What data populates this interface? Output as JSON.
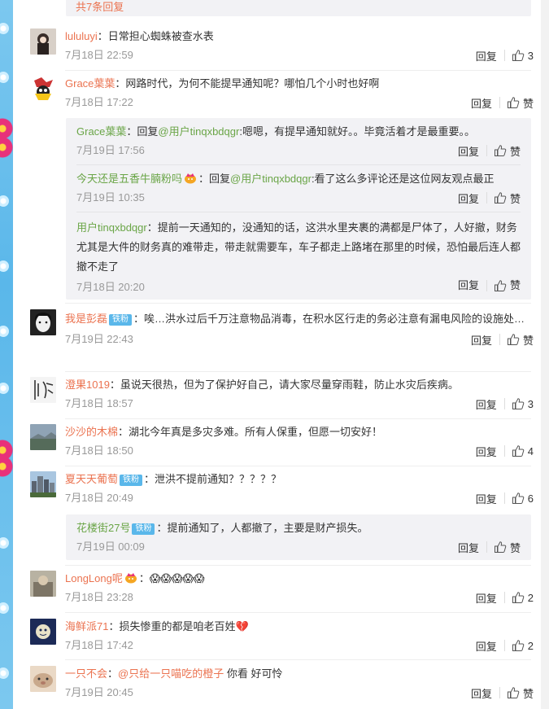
{
  "more_replies": "共7条回复",
  "reply_label": "回复",
  "like_label": "赞",
  "comments": [
    {
      "user": "lululuyi",
      "text": "：日常担心蜘蛛被查水表",
      "time": "7月18日 22:59",
      "likes": "3"
    },
    {
      "user": "Grace葉葉",
      "text": "：网路时代，为何不能提早通知呢？哪怕几个小时也好啊",
      "time": "7月18日 17:22",
      "likes": "赞",
      "replies": [
        {
          "user": "Grace葉葉",
          "pre": "：回复",
          "mention": "@用户tinqxbdqgr",
          "text": ":嗯嗯，有提早通知就好。。毕竟活着才是最重要。。",
          "time": "7月19日 17:56",
          "likes": "赞"
        },
        {
          "user": "今天还是五香牛腩粉吗",
          "pre": "：回复",
          "mention": "@用户tinqxbdqgr",
          "text": ":看了这么多评论还是这位网友观点最正",
          "time": "7月19日 10:35",
          "likes": "赞"
        },
        {
          "user": "用户tinqxbdqgr",
          "text": "：提前一天通知的，没通知的话，这洪水里夹裹的满都是尸体了，人好撤，财务尤其是大件的财务真的难带走，带走就需要车，车子都走上路堵在那里的时候，恐怕最后连人都撤不走了",
          "time": "7月18日 20:20",
          "likes": "赞"
        }
      ]
    },
    {
      "user": "我是彭磊",
      "badge": "铁粉",
      "text": "：唉…洪水过后千万注意物品消毒，在积水区行走的务必注意有漏电风险的设施处…",
      "time": "7月19日 22:43",
      "likes": "赞"
    },
    {
      "user": "澄果1019",
      "text": "：虽说天很热，但为了保护好自己，请大家尽量穿雨鞋，防止水灾后疾病。",
      "time": "7月18日 18:57",
      "likes": "3"
    },
    {
      "user": "沙沙的木棉",
      "text": "：湖北今年真是多灾多难。所有人保重，但愿一切安好！",
      "time": "7月18日 18:50",
      "likes": "4"
    },
    {
      "user": "夏天天葡萄",
      "badge": "铁粉",
      "text": "：泄洪不提前通知？？？？？",
      "time": "7月18日 20:49",
      "likes": "6",
      "replies": [
        {
          "user": "花楼街27号",
          "badge": "铁粉",
          "text": "：提前通知了，人都撤了，主要是财产损失。",
          "time": "7月19日 00:09",
          "likes": "赞"
        }
      ]
    },
    {
      "user": "LongLong呢",
      "text": "：😱😱😱😱😱",
      "time": "7月18日 23:28",
      "likes": "2"
    },
    {
      "user": "海鲜派71",
      "text": "：损失惨重的都是咱老百姓💔",
      "time": "7月18日 17:42",
      "likes": "2"
    },
    {
      "user": "一只不会",
      "pre": "：",
      "mention": "@只给一只喵吃的橙子",
      "text": " 你看 好可怜",
      "time": "7月19日 20:45",
      "likes": "赞"
    }
  ],
  "colors": {
    "link": "#eb7350",
    "green": "#6aa547",
    "badge": "#5ab7ea",
    "box": "#f2f2f5"
  }
}
